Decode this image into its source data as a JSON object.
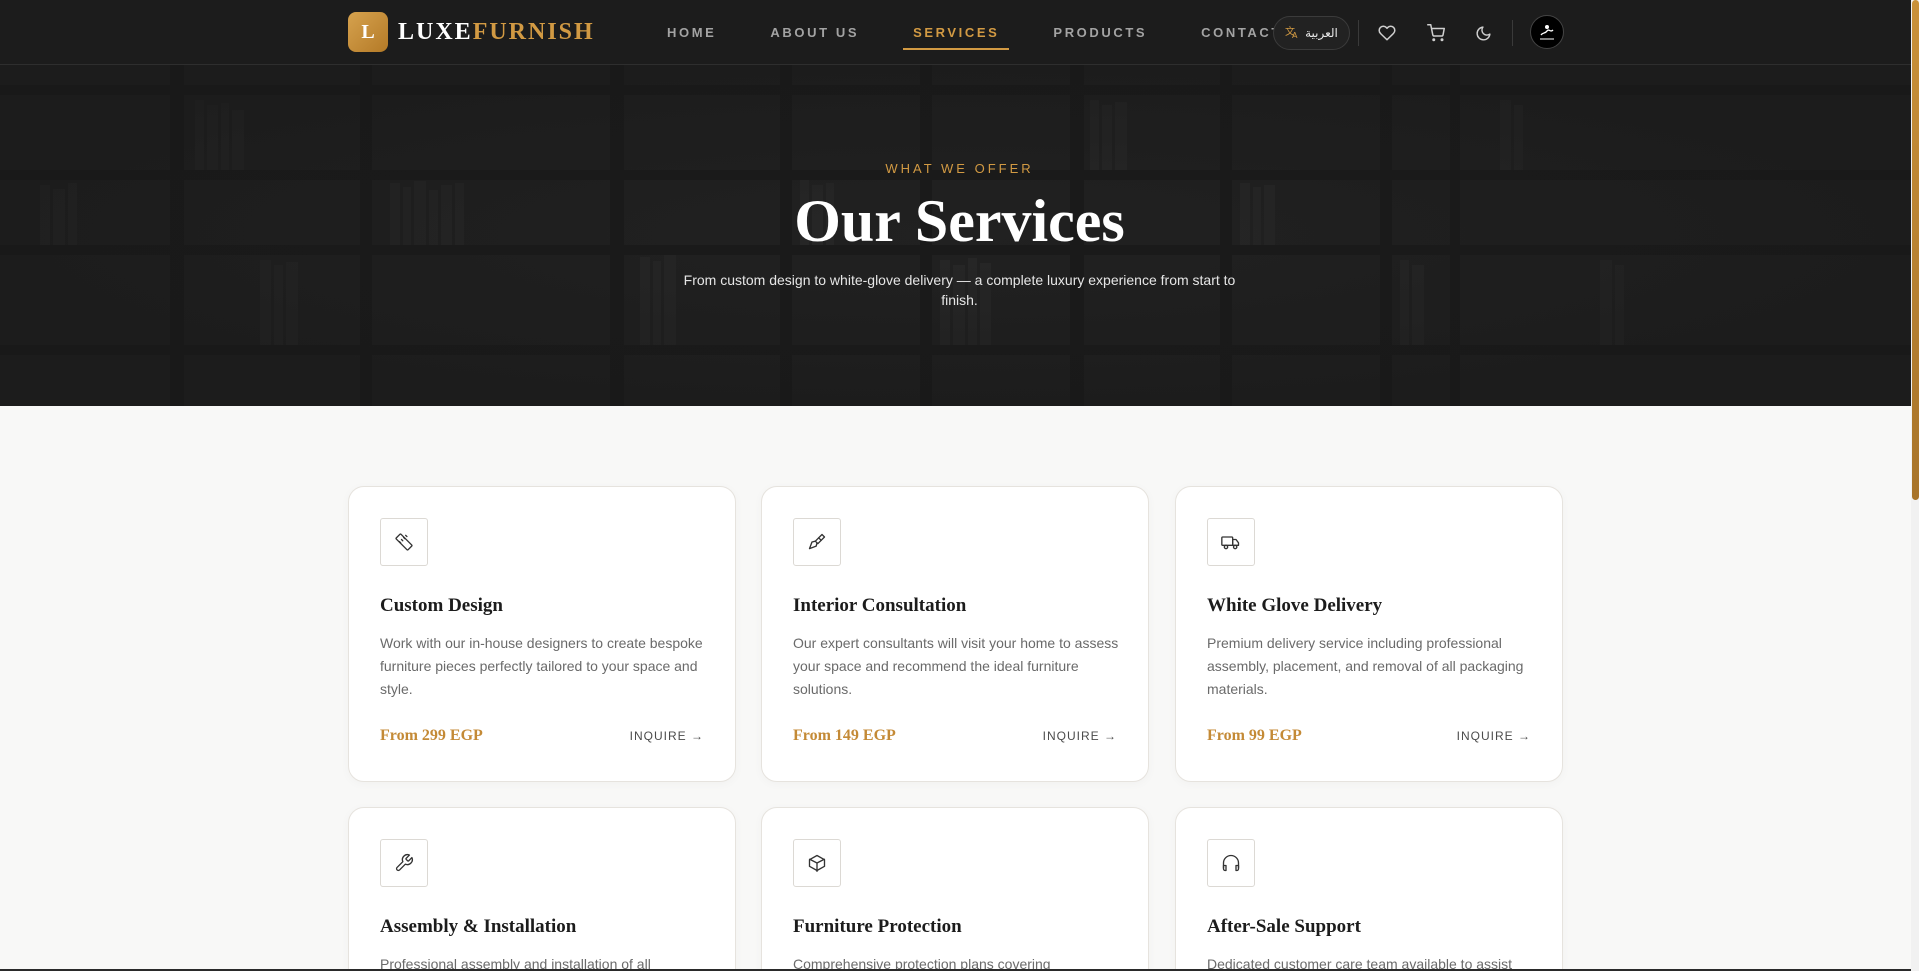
{
  "brand": {
    "mark": "L",
    "name_part1": "LUXE",
    "name_part2": "FURNISH"
  },
  "nav": {
    "items": [
      {
        "label": "HOME"
      },
      {
        "label": "ABOUT US"
      },
      {
        "label": "SERVICES",
        "active": true
      },
      {
        "label": "PRODUCTS"
      },
      {
        "label": "CONTACT"
      }
    ],
    "language_label": "العربية",
    "language_icon": "translate-icon",
    "icons": [
      "heart-icon",
      "cart-icon",
      "moon-icon"
    ],
    "avatar_icon": "user-avatar"
  },
  "hero": {
    "eyebrow": "WHAT WE OFFER",
    "title": "Our Services",
    "subtitle": "From custom design to white-glove delivery — a complete luxury experience from start to finish."
  },
  "services": [
    {
      "icon": "ruler-icon",
      "title": "Custom Design",
      "description": "Work with our in-house designers to create bespoke furniture pieces perfectly tailored to your space and style.",
      "price": "From 299 EGP",
      "cta": "INQUIRE →"
    },
    {
      "icon": "paintbrush-icon",
      "title": "Interior Consultation",
      "description": "Our expert consultants will visit your home to assess your space and recommend the ideal furniture solutions.",
      "price": "From 149 EGP",
      "cta": "INQUIRE →"
    },
    {
      "icon": "truck-icon",
      "title": "White Glove Delivery",
      "description": "Premium delivery service including professional assembly, placement, and removal of all packaging materials.",
      "price": "From 99 EGP",
      "cta": "INQUIRE →"
    },
    {
      "icon": "wrench-icon",
      "title": "Assembly & Installation",
      "description": "Professional assembly and installation of all"
    },
    {
      "icon": "box-icon",
      "title": "Furniture Protection",
      "description": "Comprehensive protection plans covering"
    },
    {
      "icon": "headphones-icon",
      "title": "After-Sale Support",
      "description": "Dedicated customer care team available to assist"
    }
  ],
  "colors": {
    "accent": "#d29a43",
    "dark": "#1c1c1c",
    "background": "#f8f8f7"
  }
}
